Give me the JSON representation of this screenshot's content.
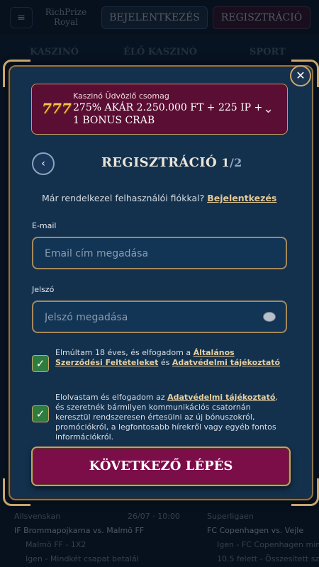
{
  "background": {
    "brand": "RichPrize\nRoyal",
    "login_label": "BEJELENTKEZÉS",
    "register_label": "REGISZTRÁCIÓ",
    "nav_tabs": [
      "KASZINÓ",
      "ÉLŐ KASZINÓ",
      "SPORT"
    ],
    "bottom": {
      "left_league": "Allsvenskan",
      "date_time": "26/07 · 10:00",
      "right_league": "Superligaen",
      "left_match": "IF Brommapojkarna vs. Malmö FF",
      "right_match": "FC Copenhagen vs. Vejle",
      "left_bet1": "Malmö FF - 1X2",
      "right_bet1": "Igen - FC Copenhagen min",
      "left_bet2": "Igen - Mindkét csapat betalál",
      "right_bet2": "10.5 felett - Összesített szö"
    }
  },
  "promo": {
    "subtitle": "Kaszinó Üdvözlő csomag",
    "title": "275% AKÁR 2.250.000 FT + 225 IP + 1 BONUS CRAB",
    "icon": "777-slots-icon"
  },
  "close_label": "✕",
  "header": {
    "back_icon": "‹",
    "title": "REGISZTRÁCIÓ",
    "step": "1",
    "total": "/2"
  },
  "have_account": {
    "text": "Már rendelkezel felhasználói fiókkal?",
    "link": "Bejelentkezés"
  },
  "email": {
    "label": "E-mail",
    "placeholder": "Email cím megadása",
    "value": ""
  },
  "password": {
    "label": "Jelszó",
    "placeholder": "Jelszó megadása",
    "value": ""
  },
  "consent1": {
    "text_before": "Elmúltam 18 éves, és elfogadom a",
    "link1": "Általános Szerződési Feltételeket",
    "text_mid": "és",
    "link2": "Adatvédelmi tájékoztató",
    "checked": true
  },
  "consent2": {
    "text_before": "Elolvastam és elfogadom az",
    "link": "Adatvédelmi tájékoztató",
    "text_after": ", és szeretnék bármilyen kommunikációs csatornán keresztül rendszeresen értesülni az új bónuszokról, promóciókról, a legfontosabb hírekről vagy egyéb fontos információkról.",
    "checked": true
  },
  "cta_label": "KÖVETKEZŐ LÉPÉS",
  "colors": {
    "accent_gold": "#c9a66b",
    "modal_bg": "#13314d",
    "cta_bg": "#7b0d49",
    "checkbox_green": "#2f7c3f"
  }
}
